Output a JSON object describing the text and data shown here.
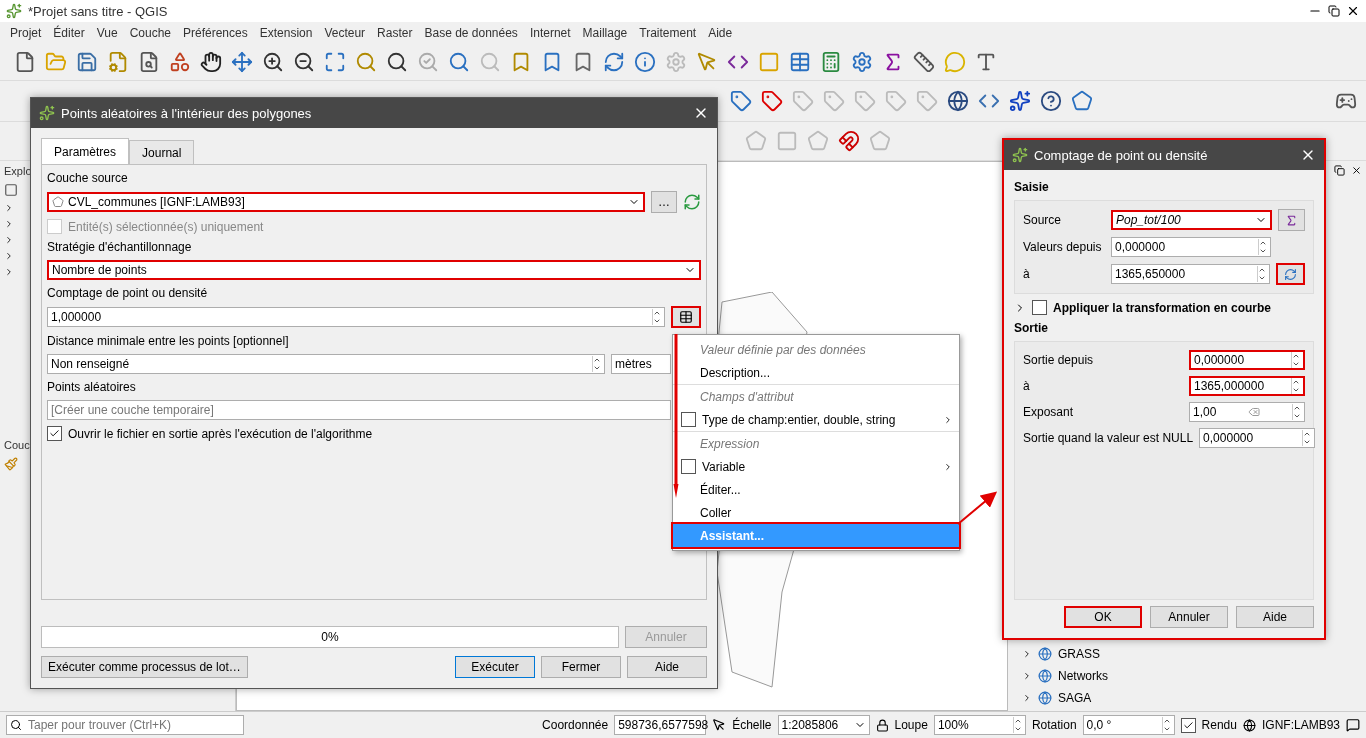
{
  "window": {
    "title": "*Projet sans titre - QGIS"
  },
  "menu": [
    "Projet",
    "Éditer",
    "Vue",
    "Couche",
    "Préférences",
    "Extension",
    "Vecteur",
    "Raster",
    "Base de données",
    "Internet",
    "Maillage",
    "Traitement",
    "Aide"
  ],
  "left_panel": {
    "browser_title": "Explo",
    "layers_title": "Couc"
  },
  "browser": {
    "items": [
      {
        "label": "GRASS"
      },
      {
        "label": "Networks"
      },
      {
        "label": "SAGA"
      }
    ]
  },
  "dialog": {
    "title": "Points aléatoires à l'intérieur des polygones",
    "tabs": [
      {
        "label": "Paramètres",
        "selected": true
      },
      {
        "label": "Journal",
        "selected": false
      }
    ],
    "source_label": "Couche source",
    "source_value": "CVL_communes [IGNF:LAMB93]",
    "source_highlighted": true,
    "browse_button": "…",
    "selected_only": {
      "label": "Entité(s) sélectionnée(s) uniquement",
      "checked": false,
      "disabled": true
    },
    "strategy_label": "Stratégie d'échantillonnage",
    "strategy_value": "Nombre de points",
    "strategy_highlighted": true,
    "count_label": "Comptage de point ou densité",
    "count_value": "1,000000",
    "dd_highlighted": true,
    "distance_label": "Distance minimale entre les points [optionnel]",
    "distance_value": "Non renseigné",
    "distance_unit": "mètres",
    "output_label": "Points aléatoires",
    "output_placeholder": "[Créer une couche temporaire]",
    "open_after": {
      "label": "Ouvrir le fichier en sortie après l'exécution de l'algorithme",
      "checked": true
    },
    "progress": {
      "level": 0,
      "text": "0%"
    },
    "cancel": {
      "label": "Annuler",
      "disabled": true
    },
    "batch_button": "Exécuter comme processus de lot…",
    "buttons": [
      {
        "label": "Exécuter",
        "default": true
      },
      {
        "label": "Fermer",
        "default": false
      },
      {
        "label": "Aide",
        "default": false
      }
    ]
  },
  "context_menu": {
    "items": [
      {
        "kind": "header",
        "label": "Valeur définie par des données"
      },
      {
        "kind": "item",
        "label": "Description...",
        "selected": false
      },
      {
        "kind": "header",
        "label": "Champs d'attribut"
      },
      {
        "kind": "check",
        "label": "Type de champ:entier, double, string",
        "checked": false,
        "submenu": true,
        "selected": false
      },
      {
        "kind": "header",
        "label": "Expression"
      },
      {
        "kind": "check",
        "label": "Variable",
        "checked": false,
        "submenu": true,
        "selected": false
      },
      {
        "kind": "item",
        "label": "Éditer...",
        "selected": false
      },
      {
        "kind": "item",
        "label": "Coller",
        "selected": false
      },
      {
        "kind": "item",
        "label": "Assistant...",
        "selected": true
      }
    ]
  },
  "assistant": {
    "title": "Comptage de point ou densité",
    "input_title": "Saisie",
    "source_label": "Source",
    "source_value": "Pop_tot/100",
    "from_label": "Valeurs depuis",
    "from_value": "0,000000",
    "to_label": "à",
    "to_value": "1365,650000",
    "curve": {
      "label": "Appliquer la transformation en courbe",
      "checked": false,
      "expanded": false
    },
    "output_title": "Sortie",
    "output_rows": [
      {
        "label": "Sortie depuis",
        "value": "0,000000",
        "highlighted": true,
        "clearable": false
      },
      {
        "label": "à",
        "value": "1365,000000",
        "highlighted": true,
        "clearable": false
      },
      {
        "label": "Exposant",
        "value": "1,00",
        "highlighted": false,
        "clearable": true
      },
      {
        "label": "Sortie quand la valeur est NULL",
        "value": "0,000000",
        "highlighted": false,
        "clearable": false
      }
    ],
    "buttons": [
      {
        "label": "OK",
        "highlighted": true
      },
      {
        "label": "Annuler",
        "highlighted": false
      },
      {
        "label": "Aide",
        "highlighted": false
      }
    ]
  },
  "status_bar": {
    "search_placeholder": "Taper pour trouver (Ctrl+K)",
    "coord_label": "Coordonnée",
    "coord_value": "598736,6577598",
    "scale_label": "Échelle",
    "scale_value": "1:2085806",
    "magnifier_label": "Loupe",
    "magnifier_value": "100%",
    "rotation_label": "Rotation",
    "rotation_value": "0,0 °",
    "render": {
      "label": "Rendu",
      "checked": true
    },
    "crs": "IGNF:LAMB93"
  }
}
